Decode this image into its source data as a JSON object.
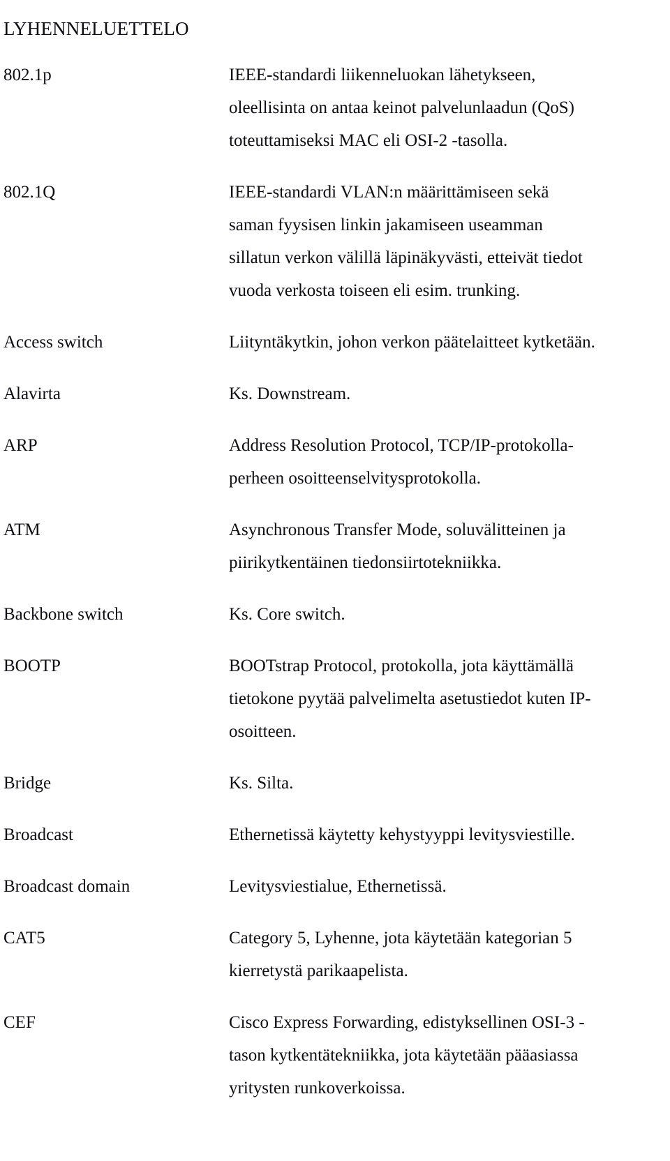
{
  "document": {
    "title": "LYHENNELUETTELO",
    "entries": [
      {
        "term": "802.1p",
        "definition_lines": [
          "IEEE-standardi liikenneluokan lähetykseen,",
          "oleellisinta on antaa keinot palvelunlaadun (QoS)",
          "toteuttamiseksi MAC eli OSI-2 -tasolla."
        ],
        "definition": "IEEE-standardi liikenneluokan lähetykseen, oleellisinta on antaa keinot palvelunlaadun (QoS) toteuttamiseksi MAC eli OSI-2 -tasolla."
      },
      {
        "term": "802.1Q",
        "definition_lines": [
          "IEEE-standardi VLAN:n määrittämiseen sekä",
          "saman fyysisen linkin jakamiseen useamman",
          "sillatun verkon välillä läpinäkyvästi, etteivät tiedot",
          "vuoda verkosta toiseen eli esim. trunking."
        ],
        "definition": "IEEE-standardi VLAN:n määrittämiseen sekä saman fyysisen linkin jakamiseen useamman sillatun verkon välillä läpinäkyvästi, etteivät tiedot vuoda verkosta toiseen eli esim. trunking."
      },
      {
        "term": "Access switch",
        "definition_lines": [
          "Liityntäkytkin, johon verkon päätelaitteet kytketään."
        ],
        "definition": "Liityntäkytkin, johon verkon päätelaitteet kytketään."
      },
      {
        "term": "Alavirta",
        "definition_lines": [
          "Ks. Downstream."
        ],
        "definition": "Ks. Downstream."
      },
      {
        "term": "ARP",
        "definition_lines": [
          "Address Resolution Protocol, TCP/IP-protokolla-",
          "perheen osoitteenselvitysprotokolla."
        ],
        "definition": "Address Resolution Protocol, TCP/IP-protokollaperheen osoitteenselvitysprotokolla."
      },
      {
        "term": "ATM",
        "definition_lines": [
          "Asynchronous Transfer Mode, soluvälitteinen ja",
          "piirikytkentäinen tiedonsiirtotekniikka."
        ],
        "definition": "Asynchronous Transfer Mode, soluvälitteinen ja piirikytkentäinen tiedonsiirtotekniikka."
      },
      {
        "term": "Backbone switch",
        "definition_lines": [
          "Ks. Core switch."
        ],
        "definition": "Ks. Core switch."
      },
      {
        "term": "BOOTP",
        "definition_lines": [
          "BOOTstrap Protocol, protokolla, jota käyttämällä",
          "tietokone pyytää palvelimelta asetustiedot kuten IP-",
          "osoitteen."
        ],
        "definition": "BOOTstrap Protocol, protokolla, jota käyttämällä tietokone pyytää palvelimelta asetustiedot kuten IP-osoitteen."
      },
      {
        "term": "Bridge",
        "definition_lines": [
          "Ks. Silta."
        ],
        "definition": "Ks. Silta."
      },
      {
        "term": "Broadcast",
        "definition_lines": [
          "Ethernetissä käytetty kehystyyppi levitysviestille."
        ],
        "definition": "Ethernetissä käytetty kehystyyppi levitysviestille."
      },
      {
        "term": "Broadcast domain",
        "definition_lines": [
          "Levitysviestialue, Ethernetissä."
        ],
        "definition": "Levitysviestialue, Ethernetissä."
      },
      {
        "term": "CAT5",
        "definition_lines": [
          "Category 5, Lyhenne, jota käytetään kategorian 5",
          "kierretystä parikaapelista."
        ],
        "definition": "Category 5, Lyhenne, jota käytetään kategorian 5 kierretystä parikaapelista."
      },
      {
        "term": "CEF",
        "definition_lines": [
          "Cisco Express Forwarding, edistyksellinen OSI-3 -",
          "tason kytkentätekniikka, jota käytetään pääasiassa",
          "yritysten runkoverkoissa."
        ],
        "definition": "Cisco Express Forwarding, edistyksellinen OSI-3 -tason kytkentätekniikka, jota käytetään pääasiassa yritysten runkoverkoissa."
      }
    ]
  }
}
